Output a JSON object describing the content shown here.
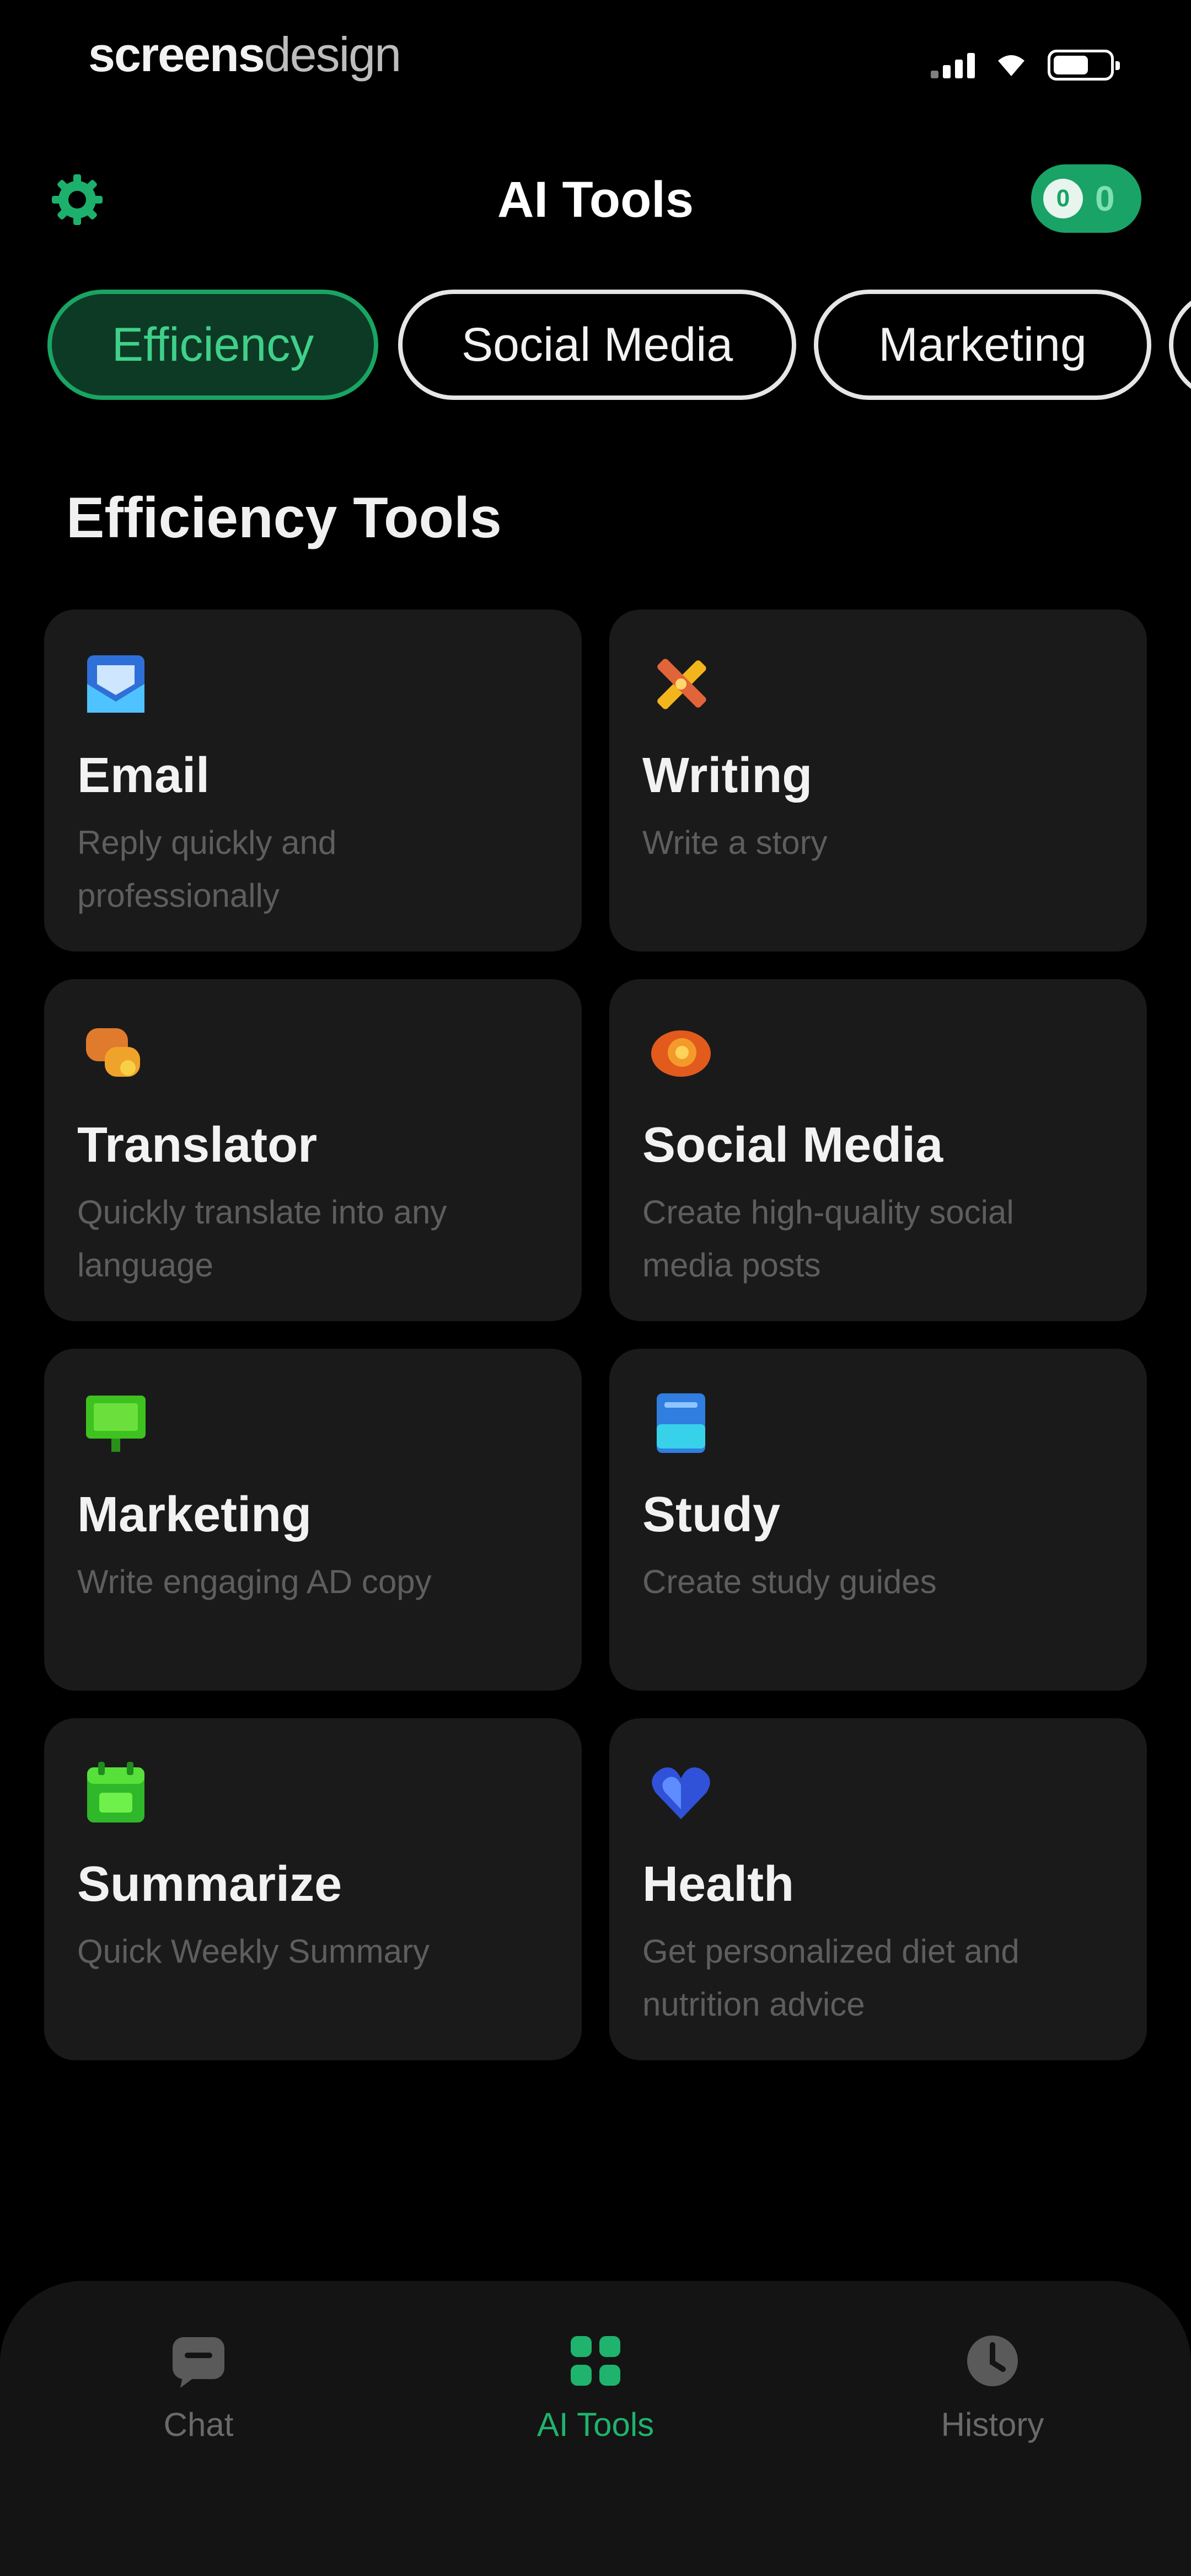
{
  "status_bar": {
    "watermark_bold": "screens",
    "watermark_light": "design",
    "icons": [
      "signal-icon",
      "wifi-icon",
      "battery-icon"
    ]
  },
  "header": {
    "title": "AI Tools",
    "settings_icon": "gear-icon",
    "credits_value": "0",
    "credits_icon_label": "0"
  },
  "tabs": [
    {
      "label": "Efficiency",
      "active": true
    },
    {
      "label": "Social Media",
      "active": false
    },
    {
      "label": "Marketing",
      "active": false
    },
    {
      "label": "",
      "active": false
    }
  ],
  "section": {
    "title": "Efficiency Tools"
  },
  "tools": [
    {
      "title": "Email",
      "desc": "Reply quickly and professionally",
      "icon": "email-icon"
    },
    {
      "title": "Writing",
      "desc": "Write a story",
      "icon": "pencil-icon"
    },
    {
      "title": "Translator",
      "desc": "Quickly translate into any language",
      "icon": "translate-icon"
    },
    {
      "title": "Social Media",
      "desc": "Create high-quality social media posts",
      "icon": "social-icon"
    },
    {
      "title": "Marketing",
      "desc": "Write engaging AD copy",
      "icon": "billboard-icon"
    },
    {
      "title": "Study",
      "desc": "Create study guides",
      "icon": "book-icon"
    },
    {
      "title": "Summarize",
      "desc": "Quick Weekly Summary",
      "icon": "calendar-icon"
    },
    {
      "title": "Health",
      "desc": "Get personalized diet and nutrition advice",
      "icon": "heart-icon"
    }
  ],
  "bottom_nav": [
    {
      "label": "Chat",
      "icon": "chat-icon",
      "active": false
    },
    {
      "label": "AI Tools",
      "icon": "grid-icon",
      "active": true
    },
    {
      "label": "History",
      "icon": "clock-icon",
      "active": false
    }
  ],
  "colors": {
    "background": "#000000",
    "card": "#1a1a1a",
    "accent": "#1aa366",
    "accent_text": "#3fd08a",
    "muted_text": "#5e5e5e"
  }
}
